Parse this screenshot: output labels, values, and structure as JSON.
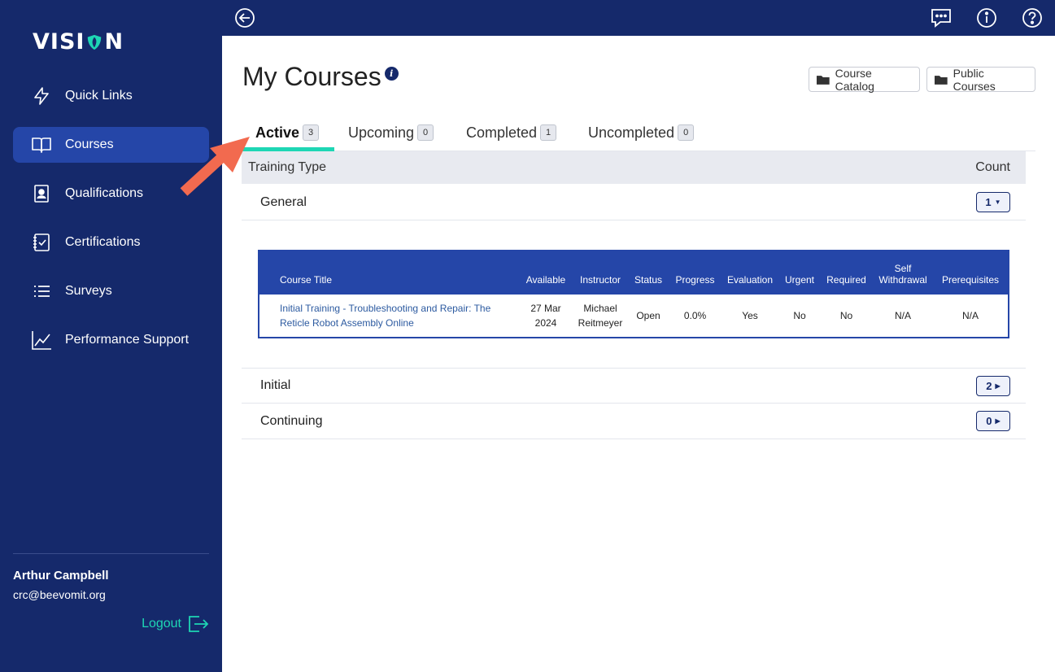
{
  "brand": {
    "name_left": "VISI",
    "name_right": "N"
  },
  "sidebar": {
    "items": [
      {
        "label": "Quick Links",
        "icon": "lightning-icon"
      },
      {
        "label": "Courses",
        "icon": "book-icon"
      },
      {
        "label": "Qualifications",
        "icon": "badge-icon"
      },
      {
        "label": "Certifications",
        "icon": "checklist-icon"
      },
      {
        "label": "Surveys",
        "icon": "list-icon"
      },
      {
        "label": "Performance Support",
        "icon": "line-chart-icon"
      }
    ],
    "active_item": "Courses"
  },
  "user": {
    "name": "Arthur Campbell",
    "email": "crc@beevomit.org",
    "logout_label": "Logout"
  },
  "topbar": {
    "icons": [
      "back-arrow-icon",
      "chat-icon",
      "info-icon",
      "help-icon"
    ]
  },
  "page": {
    "title": "My Courses"
  },
  "buttons": {
    "catalog": "Course Catalog",
    "public": "Public Courses"
  },
  "tabs": [
    {
      "label": "Active",
      "count": "3"
    },
    {
      "label": "Upcoming",
      "count": "0"
    },
    {
      "label": "Completed",
      "count": "1"
    },
    {
      "label": "Uncompleted",
      "count": "0"
    }
  ],
  "grid": {
    "header_type": "Training Type",
    "header_count": "Count",
    "groups": [
      {
        "name": "General",
        "count": "1",
        "expanded": true
      },
      {
        "name": "Initial",
        "count": "2",
        "expanded": false
      },
      {
        "name": "Continuing",
        "count": "0",
        "expanded": false
      }
    ]
  },
  "detail": {
    "columns": [
      "Course Title",
      "Available",
      "Instructor",
      "Status",
      "Progress",
      "Evaluation",
      "Urgent",
      "Required",
      "Self Withdrawal",
      "Prerequisites"
    ],
    "rows": [
      {
        "title": "Initial Training - Troubleshooting and Repair: The Reticle Robot Assembly Online",
        "available": "27 Mar 2024",
        "instructor": "Michael Reitmeyer",
        "status": "Open",
        "progress": "0.0%",
        "evaluation": "Yes",
        "urgent": "No",
        "required": "No",
        "self_withdrawal": "N/A",
        "prerequisites": "N/A"
      }
    ]
  },
  "colors": {
    "navy": "#15296b",
    "active_blue": "#2546a8",
    "accent_teal": "#1ed6b4",
    "arrow": "#f26a4f"
  }
}
